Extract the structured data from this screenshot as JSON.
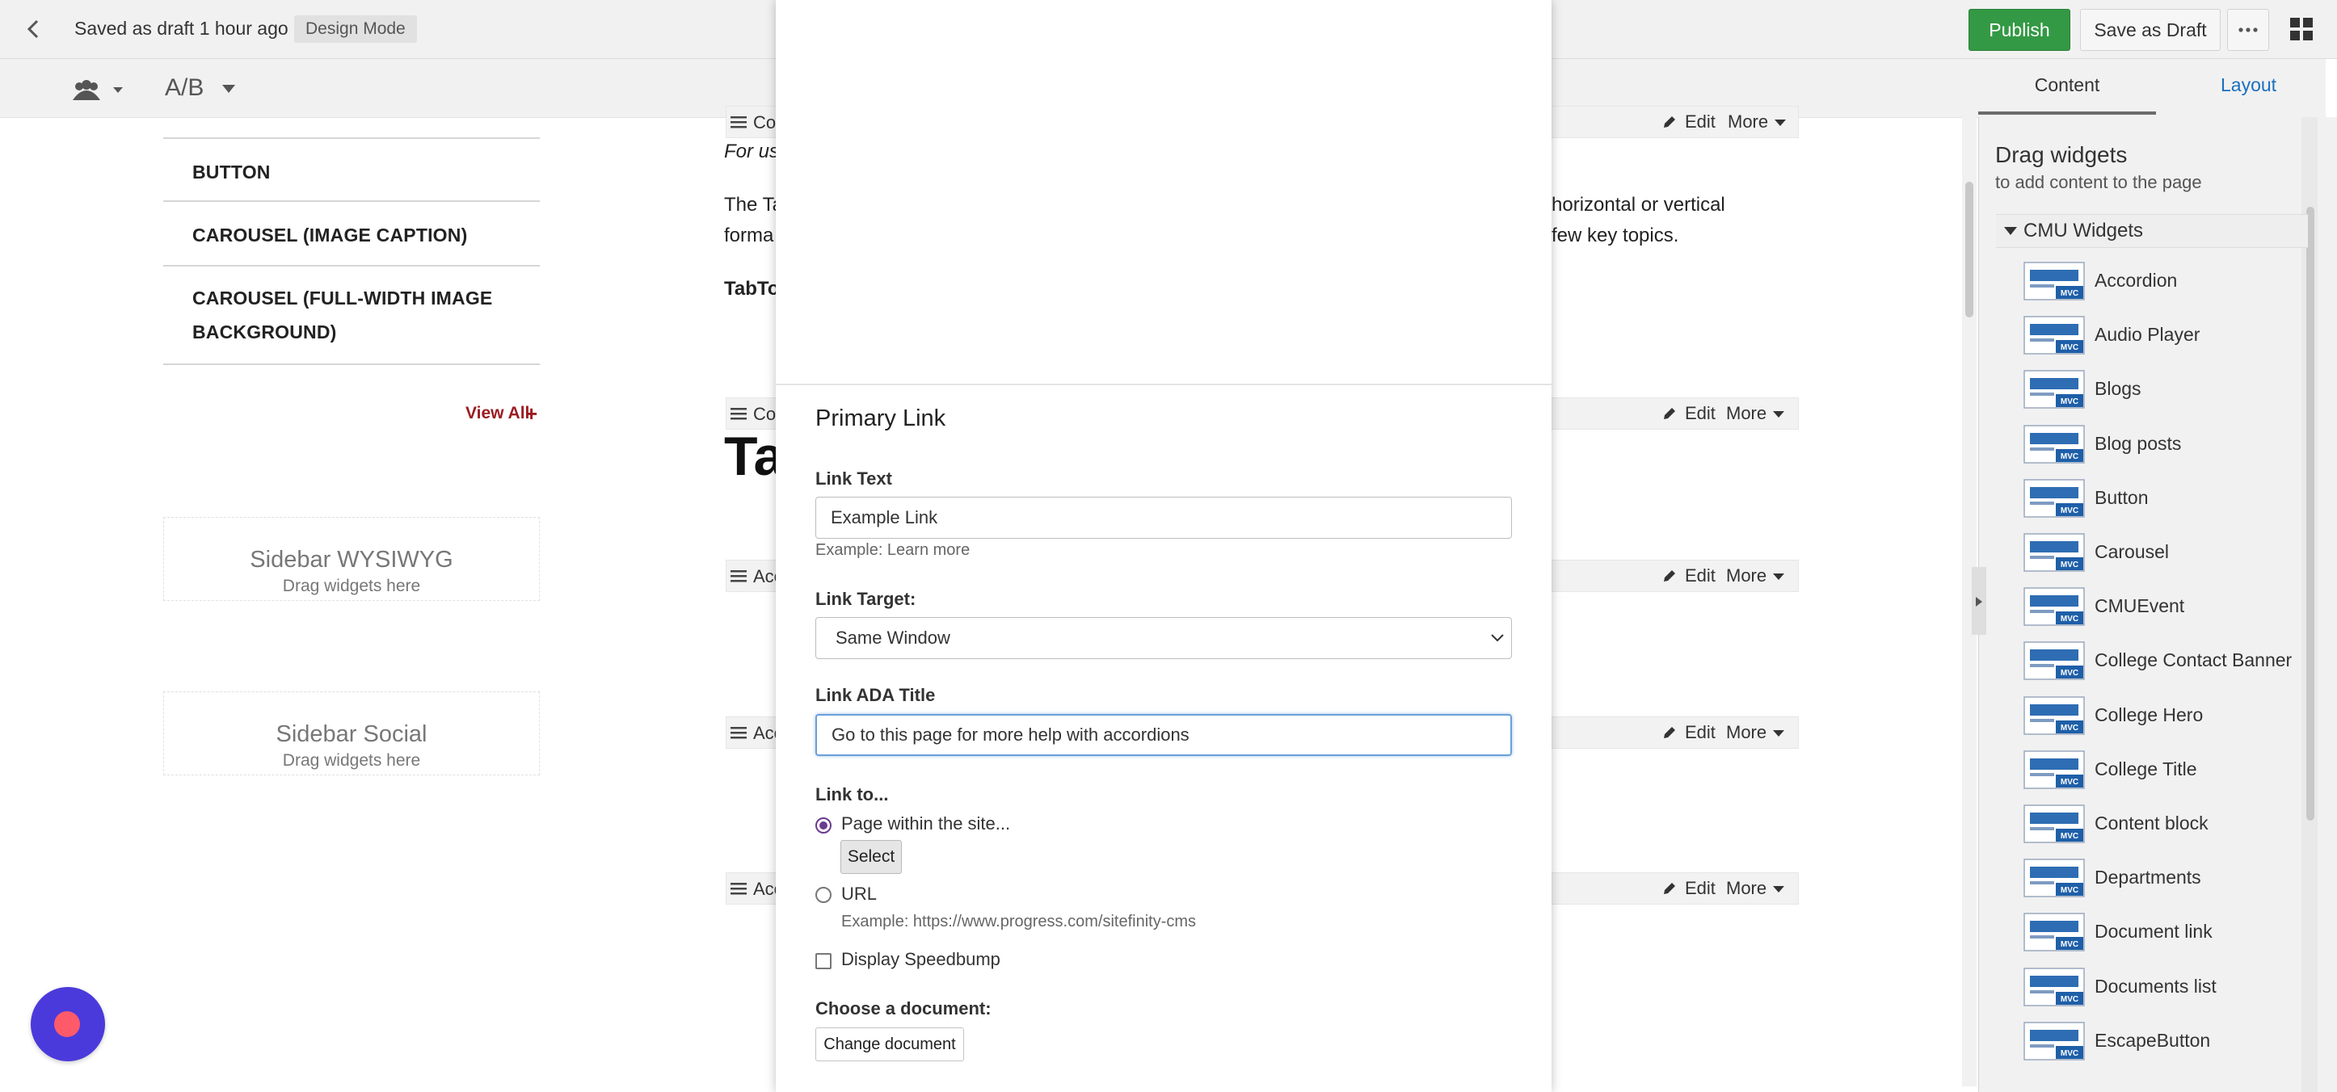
{
  "header": {
    "saved_status": "Saved as draft 1 hour ago",
    "mode_badge": "Design Mode",
    "publish_label": "Publish",
    "save_draft_label": "Save as Draft",
    "more_label": "···"
  },
  "toolbar": {
    "ab_label": "A/B"
  },
  "sidebar_nav": {
    "items": [
      "BUTTON",
      "CAROUSEL (IMAGE CAPTION)",
      "CAROUSEL (FULL-WIDTH IMAGE",
      "BACKGROUND)"
    ],
    "view_all": "View All",
    "view_all_plus": "+"
  },
  "drop_zones": [
    {
      "title": "Sidebar WYSIWYG",
      "hint": "Drag widgets here"
    },
    {
      "title": "Sidebar Social",
      "hint": "Drag widgets here"
    }
  ],
  "widget_bars": {
    "names": [
      "Co",
      "Co",
      "Acc",
      "Acc",
      "Acc"
    ],
    "edit_label": "Edit",
    "more_label": "More"
  },
  "page_content": {
    "intro_italic": "For us",
    "para_left_1": "The Ta",
    "para_right_1": "horizontal or vertical",
    "para_left_2": "forma",
    "para_right_2": "few key topics.",
    "bold_label": "TabTo",
    "big_title": "Ta"
  },
  "right_panel": {
    "tab_content": "Content",
    "tab_layout": "Layout",
    "drag_title": "Drag widgets",
    "drag_sub": "to add content to the page",
    "category": "CMU Widgets",
    "widgets": [
      "Accordion",
      "Audio Player",
      "Blogs",
      "Blog posts",
      "Button",
      "Carousel",
      "CMUEvent",
      "College Contact Banner",
      "College Hero",
      "College Title",
      "Content block",
      "Departments",
      "Document link",
      "Documents list",
      "EscapeButton"
    ],
    "mvc_badge": "MVC"
  },
  "modal": {
    "section_title": "Primary Link",
    "link_text_label": "Link Text",
    "link_text_value": "Example Link",
    "link_text_hint": "Example: Learn more",
    "link_target_label": "Link Target:",
    "link_target_value": "Same Window",
    "ada_title_label": "Link ADA Title",
    "ada_title_value": "Go to this page for more help with accordions",
    "link_to_label": "Link to...",
    "option_page": "Page within the site...",
    "select_label": "Select",
    "option_url": "URL",
    "url_hint": "Example: https://www.progress.com/sitefinity-cms",
    "speedbump_label": "Display Speedbump",
    "choose_doc_label": "Choose a document:",
    "change_doc_label": "Change document"
  },
  "colors": {
    "publish_green": "#339944",
    "link_blue": "#1a6fbf",
    "view_all_red": "#9b1c22",
    "radio_purple": "#6a3b8f",
    "chat_purple": "#4b3adb",
    "chat_dot": "#ff5a6a",
    "mvc_blue": "#1e5fa8"
  },
  "icons": {
    "back": "chevron-left-icon",
    "grid": "grid-icon",
    "personas": "users-icon",
    "edit": "pencil-icon",
    "handle": "drag-handle-icon",
    "widget": "mvc-widget-icon"
  }
}
